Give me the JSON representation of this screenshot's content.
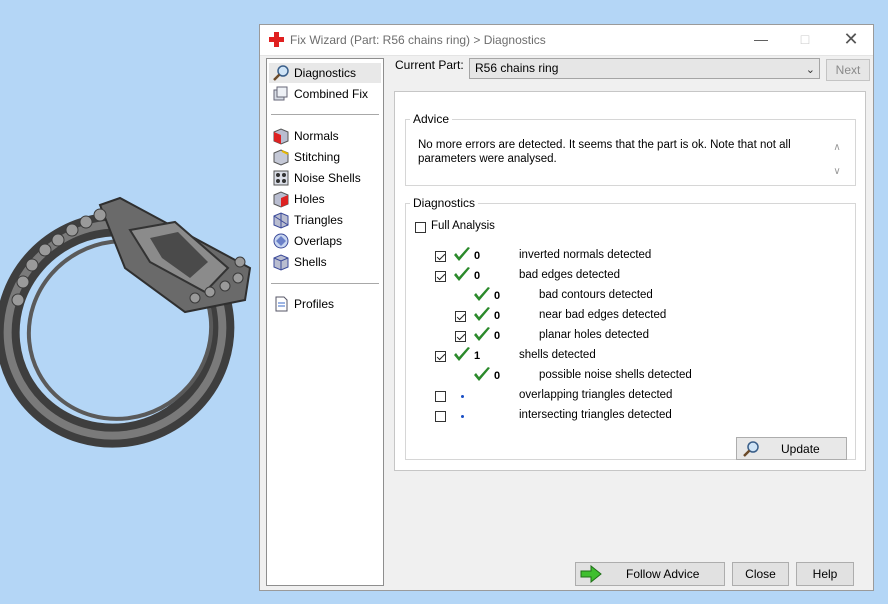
{
  "window": {
    "title": "Fix Wizard (Part: R56 chains ring) > Diagnostics"
  },
  "nav": {
    "items": [
      {
        "label": "Diagnostics",
        "icon": "magnifier-icon",
        "selected": true
      },
      {
        "label": "Combined Fix",
        "icon": "combined-fix-icon"
      },
      {
        "label": "Normals",
        "icon": "normals-icon"
      },
      {
        "label": "Stitching",
        "icon": "stitching-icon"
      },
      {
        "label": "Noise Shells",
        "icon": "noise-shells-icon"
      },
      {
        "label": "Holes",
        "icon": "holes-icon"
      },
      {
        "label": "Triangles",
        "icon": "triangles-icon"
      },
      {
        "label": "Overlaps",
        "icon": "overlaps-icon"
      },
      {
        "label": "Shells",
        "icon": "shells-icon"
      },
      {
        "label": "Profiles",
        "icon": "profiles-icon"
      }
    ]
  },
  "current_part": {
    "label": "Current Part:",
    "value": "R56 chains ring"
  },
  "next_label": "Next",
  "advice": {
    "title": "Advice",
    "text": "No more errors are detected. It seems that the part is ok. Note that not all parameters were analysed."
  },
  "diagnostics": {
    "title": "Diagnostics",
    "full_analysis": {
      "label": "Full Analysis",
      "checked": false
    },
    "rows": [
      {
        "checkbox": true,
        "checked": true,
        "status": "ok",
        "count": "0",
        "label": "inverted normals detected"
      },
      {
        "checkbox": true,
        "checked": true,
        "status": "ok",
        "count": "0",
        "label": "bad edges detected"
      },
      {
        "checkbox": false,
        "status": "ok",
        "count": "0",
        "label": "bad contours detected"
      },
      {
        "checkbox": true,
        "checked": true,
        "status": "ok",
        "count": "0",
        "label": "near bad edges detected"
      },
      {
        "checkbox": true,
        "checked": true,
        "status": "ok",
        "count": "0",
        "label": "planar holes detected"
      },
      {
        "checkbox": true,
        "checked": true,
        "status": "ok",
        "count": "1",
        "label": "shells detected"
      },
      {
        "checkbox": false,
        "status": "ok",
        "count": "0",
        "label": "possible noise shells detected"
      },
      {
        "checkbox": true,
        "checked": false,
        "status": "pending",
        "count": "",
        "label": "overlapping triangles detected"
      },
      {
        "checkbox": true,
        "checked": false,
        "status": "pending",
        "count": "",
        "label": "intersecting triangles detected"
      }
    ],
    "update_label": "Update"
  },
  "buttons": {
    "follow_advice": "Follow Advice",
    "close": "Close",
    "help": "Help"
  },
  "colors": {
    "background": "#b4d6f6",
    "ok_tick": "#2b8a2b",
    "pending_dot": "#1a4fc4",
    "title_icon": "#e02020"
  }
}
